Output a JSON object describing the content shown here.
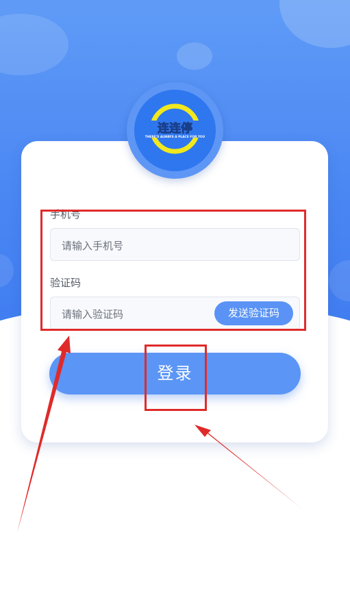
{
  "logo": {
    "brand_text": "连连停",
    "slogan": "THERE'S ALWAYS A PLACE FOR YOU"
  },
  "form": {
    "phone_label": "手机号",
    "phone_placeholder": "请输入手机号",
    "code_label": "验证码",
    "code_placeholder": "请输入验证码",
    "send_code_label": "发送验证码",
    "login_label": "登录"
  },
  "colors": {
    "primary": "#5b95f6",
    "header": "#4a86f3",
    "annotation": "#e02a2a"
  }
}
